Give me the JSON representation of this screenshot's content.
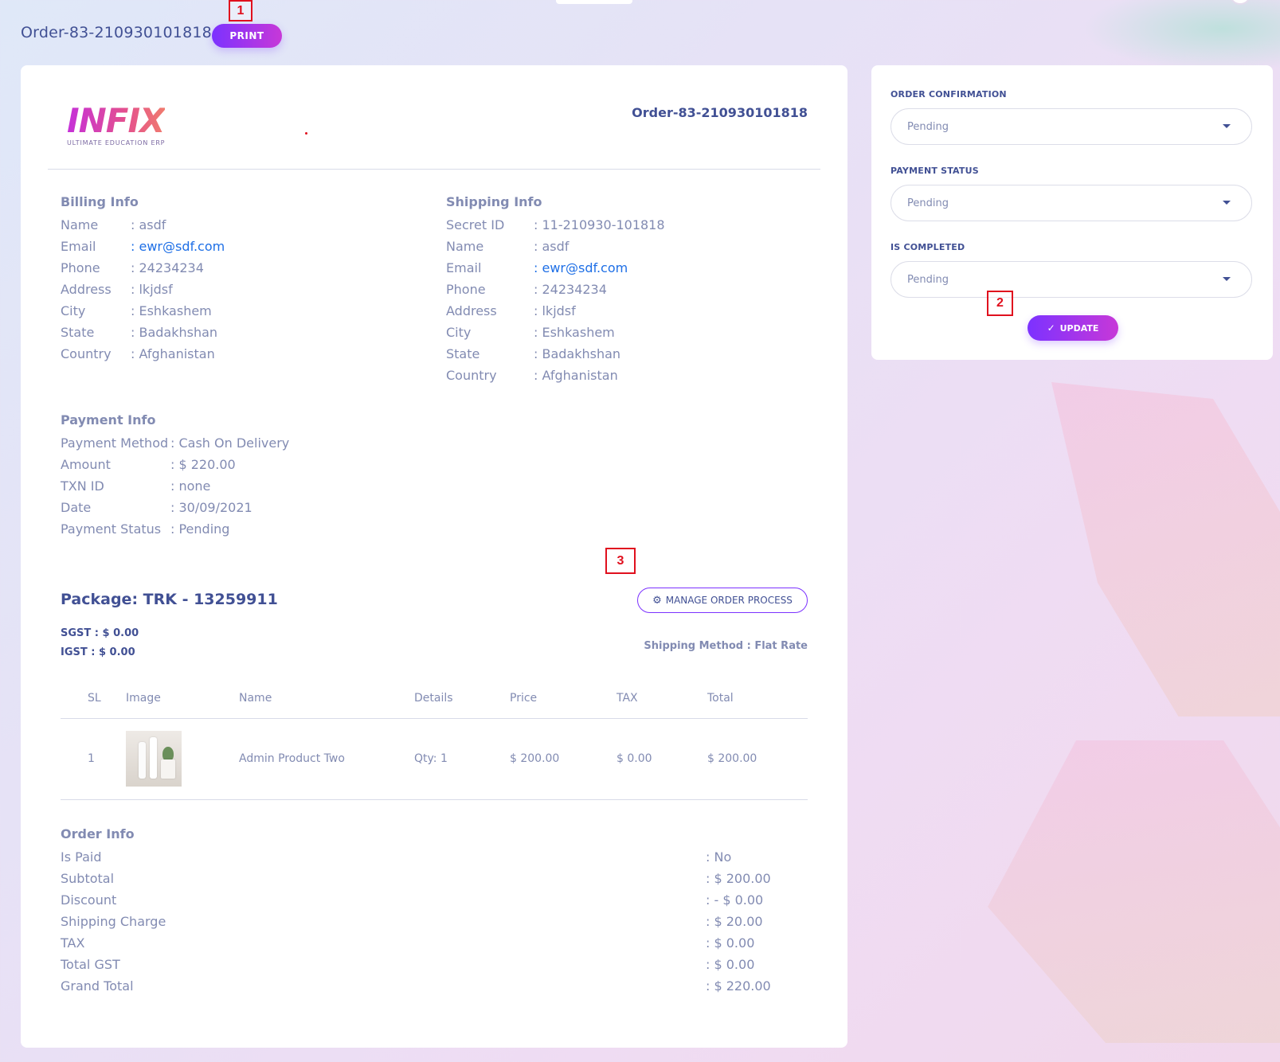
{
  "page": {
    "title": "Order-83-210930101818",
    "print_label": "PRINT"
  },
  "markers": [
    "1",
    "2",
    "3"
  ],
  "logo": {
    "name": "INFIX",
    "tagline": "ULTIMATE EDUCATION ERP"
  },
  "order": {
    "number": "Order-83-210930101818"
  },
  "billing": {
    "title": "Billing Info",
    "rows": [
      {
        "label": "Name",
        "value": ": asdf"
      },
      {
        "label": "Email",
        "value": ": ewr@sdf.com"
      },
      {
        "label": "Phone",
        "value": ": 24234234"
      },
      {
        "label": "Address",
        "value": ": lkjdsf"
      },
      {
        "label": "City",
        "value": ": Eshkashem"
      },
      {
        "label": "State",
        "value": ": Badakhshan"
      },
      {
        "label": "Country",
        "value": ": Afghanistan"
      }
    ]
  },
  "shipping": {
    "title": "Shipping Info",
    "rows": [
      {
        "label": "Secret ID",
        "value": ": 11-210930-101818"
      },
      {
        "label": "Name",
        "value": ": asdf"
      },
      {
        "label": "Email",
        "value": ": ewr@sdf.com"
      },
      {
        "label": "Phone",
        "value": ": 24234234"
      },
      {
        "label": "Address",
        "value": ": lkjdsf"
      },
      {
        "label": "City",
        "value": ": Eshkashem"
      },
      {
        "label": "State",
        "value": ": Badakhshan"
      },
      {
        "label": "Country",
        "value": ": Afghanistan"
      }
    ]
  },
  "payment": {
    "title": "Payment Info",
    "rows": [
      {
        "label": "Payment Method",
        "value": ": Cash On Delivery"
      },
      {
        "label": "Amount",
        "value": ": $ 220.00"
      },
      {
        "label": "TXN ID",
        "value": ": none"
      },
      {
        "label": "Date",
        "value": ": 30/09/2021"
      },
      {
        "label": "Payment Status",
        "value": ": Pending"
      }
    ]
  },
  "package": {
    "title": "Package: TRK - 13259911",
    "manage_label": "MANAGE ORDER PROCESS",
    "sgst": "SGST : $ 0.00",
    "igst": "IGST : $ 0.00",
    "shipping_method": "Shipping Method : Flat Rate"
  },
  "items_table": {
    "headers": [
      "SL",
      "Image",
      "Name",
      "Details",
      "Price",
      "TAX",
      "Total"
    ],
    "rows": [
      {
        "sl": "1",
        "name": "Admin Product Two",
        "details": "Qty: 1",
        "price": "$ 200.00",
        "tax": "$ 0.00",
        "total": "$ 200.00"
      }
    ]
  },
  "order_info": {
    "title": "Order Info",
    "rows": [
      {
        "label": "Is Paid",
        "value": ": No"
      },
      {
        "label": "Subtotal",
        "value": ": $ 200.00"
      },
      {
        "label": "Discount",
        "value": ": - $ 0.00"
      },
      {
        "label": "Shipping Charge",
        "value": ": $ 20.00"
      },
      {
        "label": "TAX",
        "value": ": $ 0.00"
      },
      {
        "label": "Total GST",
        "value": ": $ 0.00"
      },
      {
        "label": "Grand Total",
        "value": ": $ 220.00"
      }
    ]
  },
  "status_panel": {
    "order_confirmation_label": "ORDER CONFIRMATION",
    "order_confirmation_value": "Pending",
    "payment_status_label": "PAYMENT STATUS",
    "payment_status_value": "Pending",
    "is_completed_label": "IS COMPLETED",
    "is_completed_value": "Pending",
    "update_label": "UPDATE"
  },
  "colors": {
    "accent_start": "#7c32ff",
    "accent_end": "#c738d8",
    "heading": "#415094",
    "text": "#828bb2",
    "link": "#1e6fe6"
  }
}
